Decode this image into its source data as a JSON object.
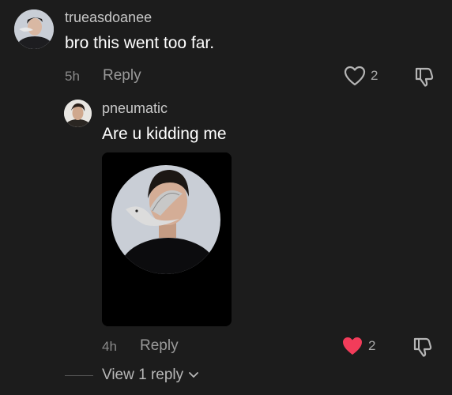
{
  "comments": [
    {
      "username": "trueasdoanee",
      "text": "bro this went too far.",
      "time": "5h",
      "reply_label": "Reply",
      "like_count": "2",
      "liked": false
    },
    {
      "username": "pneumatic",
      "text": "Are u kidding me",
      "time": "4h",
      "reply_label": "Reply",
      "like_count": "2",
      "liked": true
    }
  ],
  "view_replies_label": "View 1 reply",
  "colors": {
    "background": "#1c1c1c",
    "liked_heart": "#f23c5a",
    "muted_text": "#8a8a8a"
  },
  "icons": {
    "like": "heart-outline-icon",
    "liked": "heart-filled-icon",
    "dislike": "thumbs-down-icon",
    "expand": "chevron-down-icon"
  }
}
